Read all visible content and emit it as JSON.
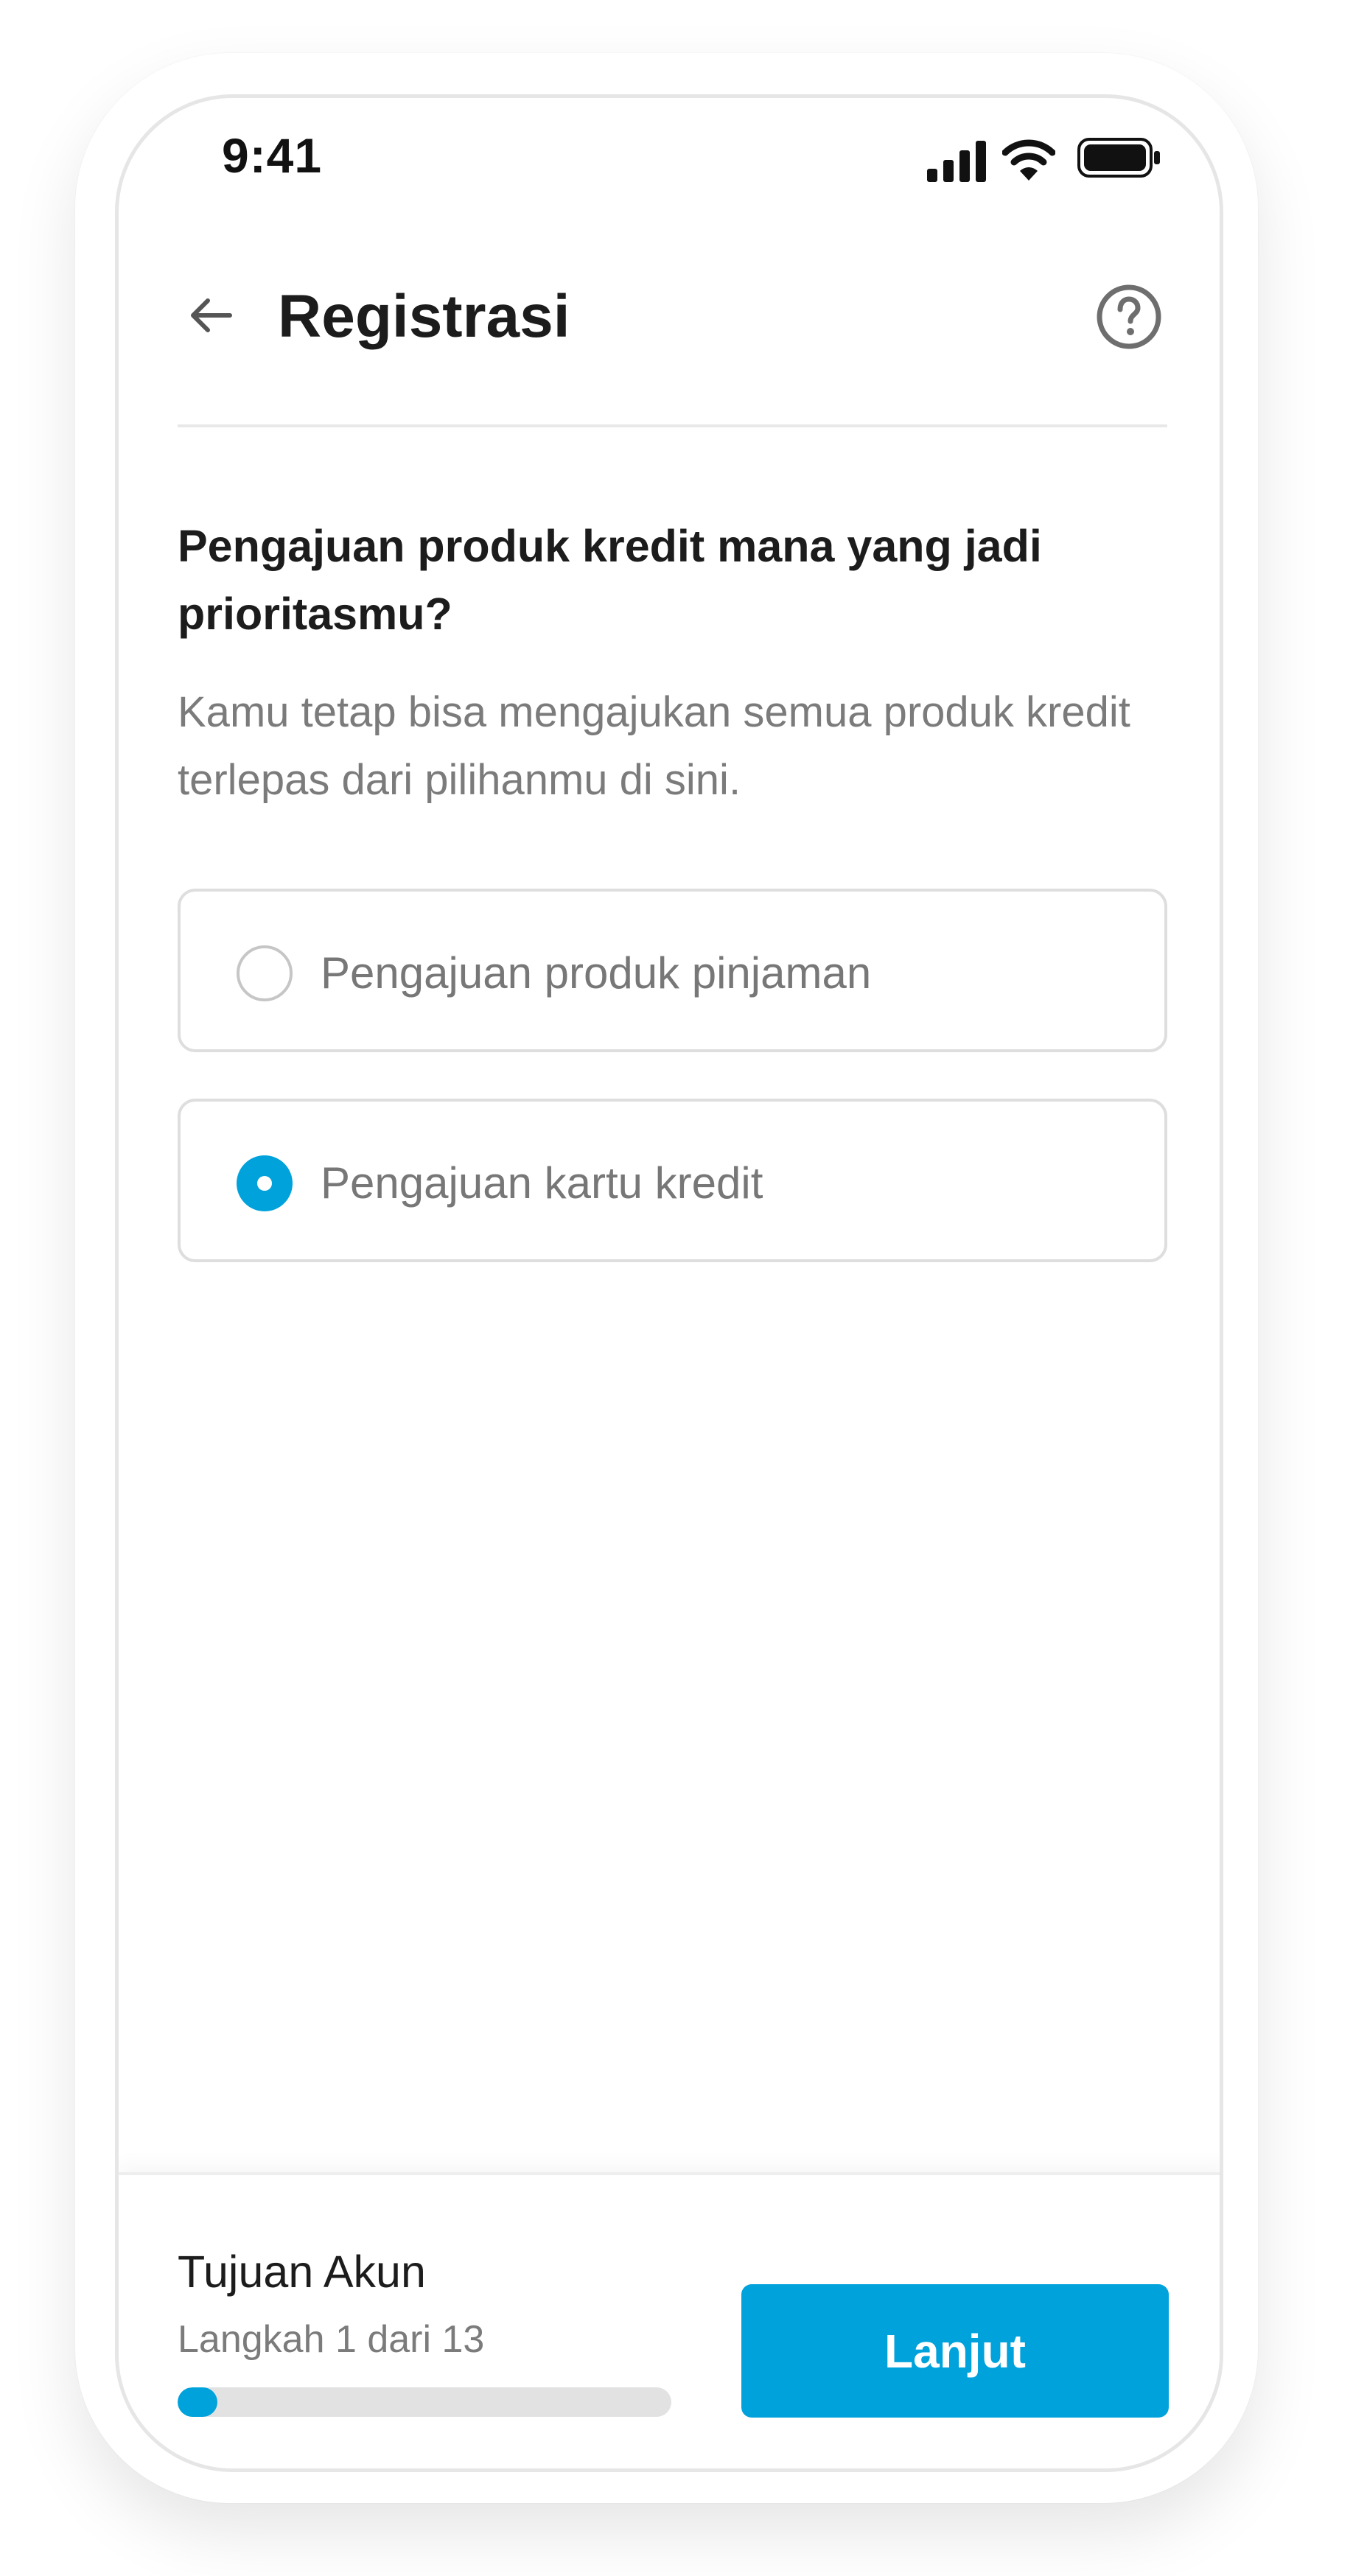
{
  "status_bar": {
    "time": "9:41",
    "icons": [
      "signal-icon",
      "wifi-icon",
      "battery-icon"
    ]
  },
  "header": {
    "title": "Registrasi",
    "back_icon": "arrow-left-icon",
    "help_icon": "question-circle-icon"
  },
  "question": {
    "title": "Pengajuan produk kredit mana yang jadi prioritasmu?",
    "subtitle": "Kamu tetap bisa mengajukan semua produk kredit terlepas dari pilihanmu di sini."
  },
  "options": [
    {
      "label": "Pengajuan produk pinjaman",
      "selected": false
    },
    {
      "label": "Pengajuan kartu kredit",
      "selected": true
    }
  ],
  "footer": {
    "step_title": "Tujuan Akun",
    "step_count": "Langkah 1 dari 13",
    "progress": {
      "current": 1,
      "total": 13
    },
    "next_label": "Lanjut"
  },
  "colors": {
    "accent": "#00a2dc",
    "text_primary": "#1c1c1c",
    "text_secondary": "#7b7b7b",
    "border": "#dedede"
  }
}
